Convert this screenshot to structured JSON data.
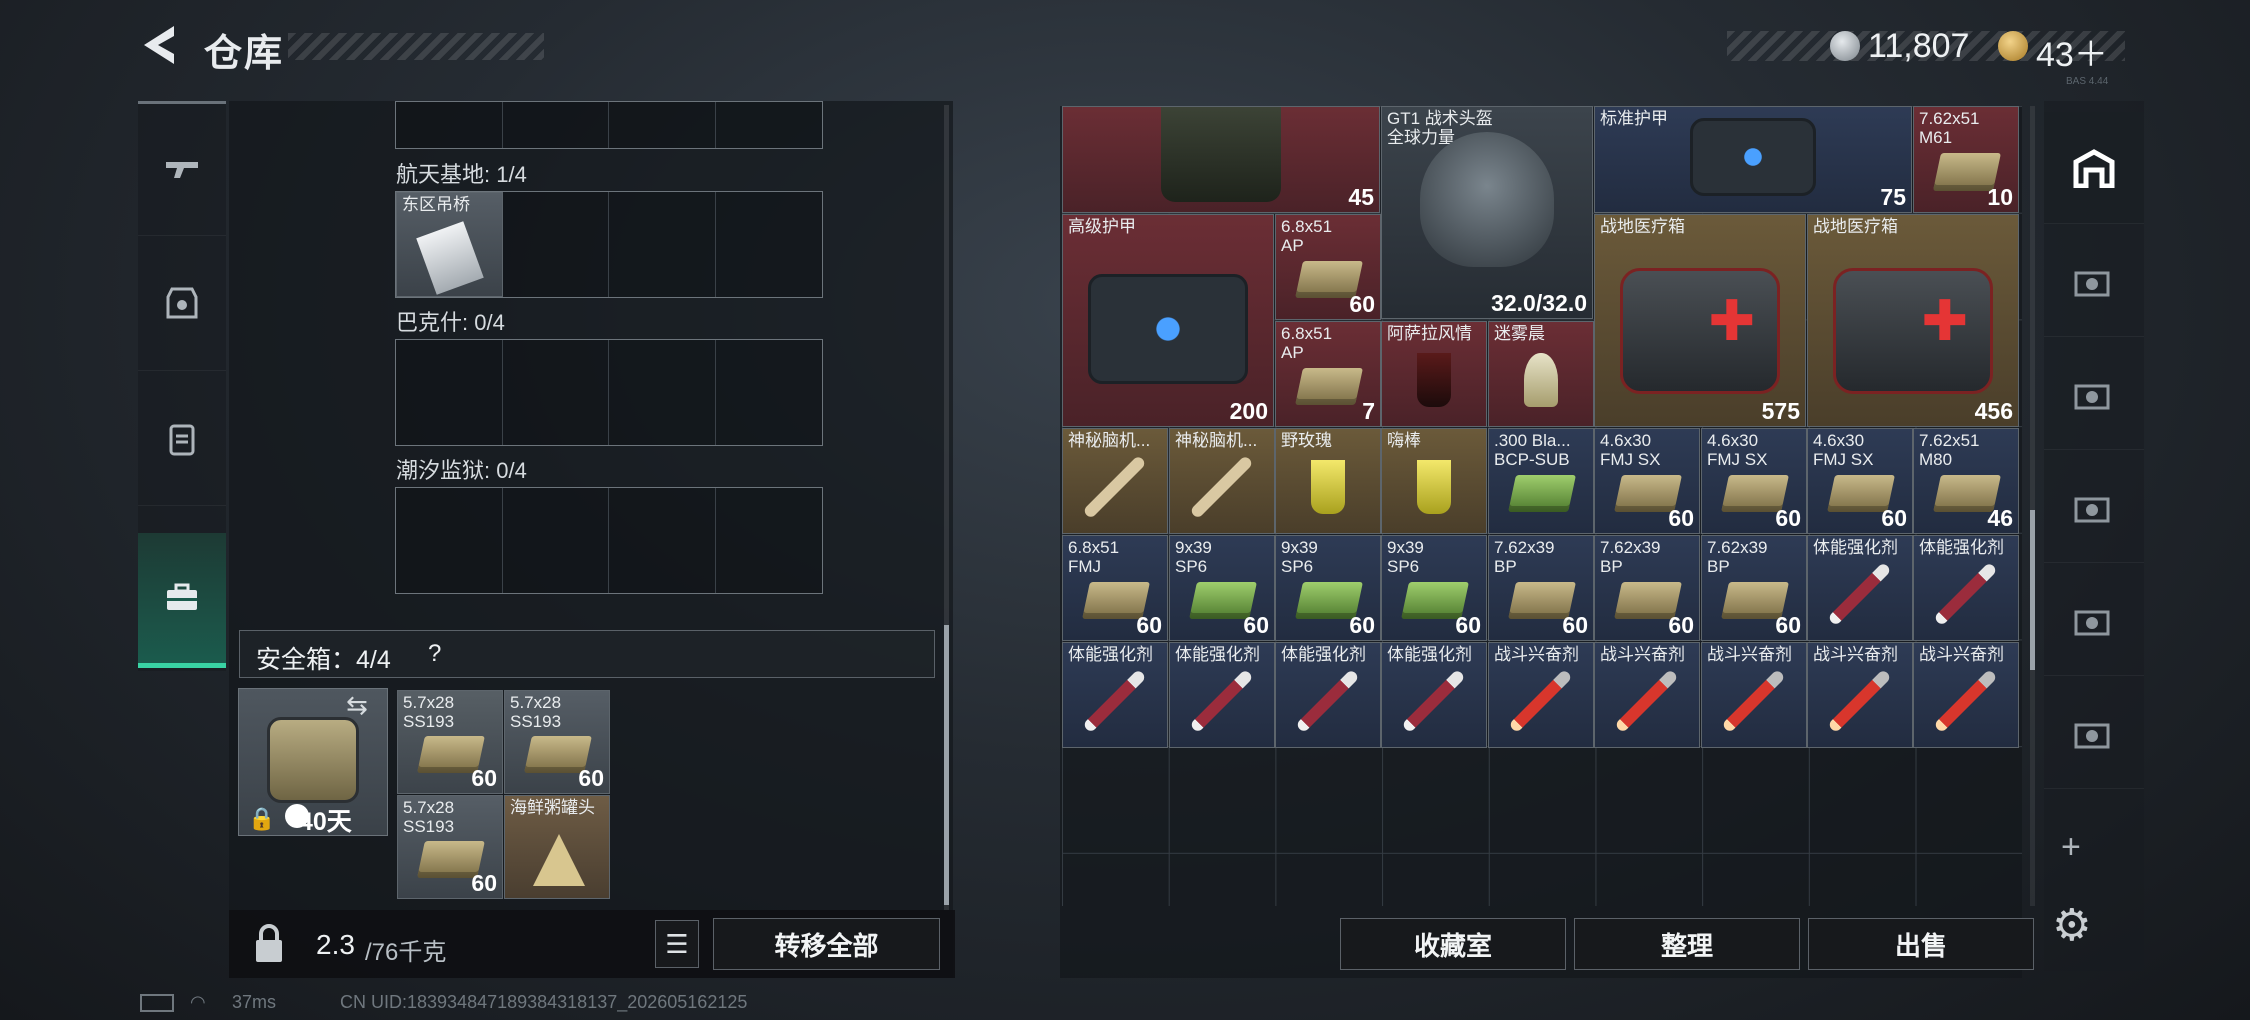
{
  "header": {
    "title": "仓库",
    "coins": "11,807",
    "gold": "43＋",
    "version": "BAS 4.44"
  },
  "leftnav": {
    "items": [
      "gun-tab",
      "armor-tab",
      "backpack-tab",
      "case-tab"
    ]
  },
  "left": {
    "sections": [
      {
        "label": "航天基地: 1/4"
      },
      {
        "label": "巴克什: 0/4"
      },
      {
        "label": "潮汐监狱: 0/4"
      }
    ],
    "keycard": "东区吊桥",
    "safebox": {
      "label": "安全箱：4/4",
      "help": "?",
      "days": "40天"
    },
    "safe_items": [
      {
        "name": "5.7x28\nSS193",
        "count": "60"
      },
      {
        "name": "5.7x28\nSS193",
        "count": "60"
      },
      {
        "name": "5.7x28\nSS193",
        "count": "60"
      },
      {
        "name": "海鲜粥罐头",
        "count": ""
      }
    ],
    "weight": {
      "current": "2.3",
      "max": "/76千克"
    },
    "transfer_all": "转移全部"
  },
  "right": {
    "items": [
      {
        "name": "",
        "count": "45"
      },
      {
        "name": "GT1 战术头盔\n全球力量",
        "count": "32.0/32.0"
      },
      {
        "name": "标准护甲",
        "count": "75"
      },
      {
        "name": "7.62x51\nM61",
        "count": "10"
      },
      {
        "name": "高级护甲",
        "count": "200"
      },
      {
        "name": "6.8x51\nAP",
        "count": "60"
      },
      {
        "name": "6.8x51\nAP",
        "count": "7"
      },
      {
        "name": "阿萨拉风情",
        "count": ""
      },
      {
        "name": "迷雾晨",
        "count": ""
      },
      {
        "name": "战地医疗箱",
        "count": "575"
      },
      {
        "name": "战地医疗箱",
        "count": "456"
      },
      {
        "name": "神秘脑机...",
        "count": ""
      },
      {
        "name": "神秘脑机...",
        "count": ""
      },
      {
        "name": "野玫瑰",
        "count": ""
      },
      {
        "name": "嗨棒",
        "count": ""
      },
      {
        "name": ".300 Bla...\nBCP-SUB",
        "count": ""
      },
      {
        "name": "4.6x30\nFMJ SX",
        "count": "60"
      },
      {
        "name": "4.6x30\nFMJ SX",
        "count": "60"
      },
      {
        "name": "4.6x30\nFMJ SX",
        "count": "60"
      },
      {
        "name": "7.62x51\nM80",
        "count": "46"
      },
      {
        "name": "6.8x51\nFMJ",
        "count": "60"
      },
      {
        "name": "9x39\nSP6",
        "count": "60"
      },
      {
        "name": "9x39\nSP6",
        "count": "60"
      },
      {
        "name": "9x39\nSP6",
        "count": "60"
      },
      {
        "name": "7.62x39\nBP",
        "count": "60"
      },
      {
        "name": "7.62x39\nBP",
        "count": "60"
      },
      {
        "name": "7.62x39\nBP",
        "count": "60"
      },
      {
        "name": "体能强化剂",
        "count": ""
      },
      {
        "name": "体能强化剂",
        "count": ""
      },
      {
        "name": "体能强化剂",
        "count": ""
      },
      {
        "name": "体能强化剂",
        "count": ""
      },
      {
        "name": "体能强化剂",
        "count": ""
      },
      {
        "name": "体能强化剂",
        "count": ""
      },
      {
        "name": "战斗兴奋剂",
        "count": ""
      },
      {
        "name": "战斗兴奋剂",
        "count": ""
      },
      {
        "name": "战斗兴奋剂",
        "count": ""
      },
      {
        "name": "战斗兴奋剂",
        "count": ""
      },
      {
        "name": "战斗兴奋剂",
        "count": ""
      }
    ],
    "buttons": {
      "collection": "收藏室",
      "sort": "整理",
      "sell": "出售"
    }
  },
  "status": {
    "ping": "37ms",
    "uid": "CN UID:183934847189384318137_202605162125"
  },
  "colors": {
    "accent": "#39d3a4",
    "rarity_red": "#5a2a2f",
    "rarity_blue": "#2a3a55",
    "rarity_gold": "#6b5a3a"
  }
}
